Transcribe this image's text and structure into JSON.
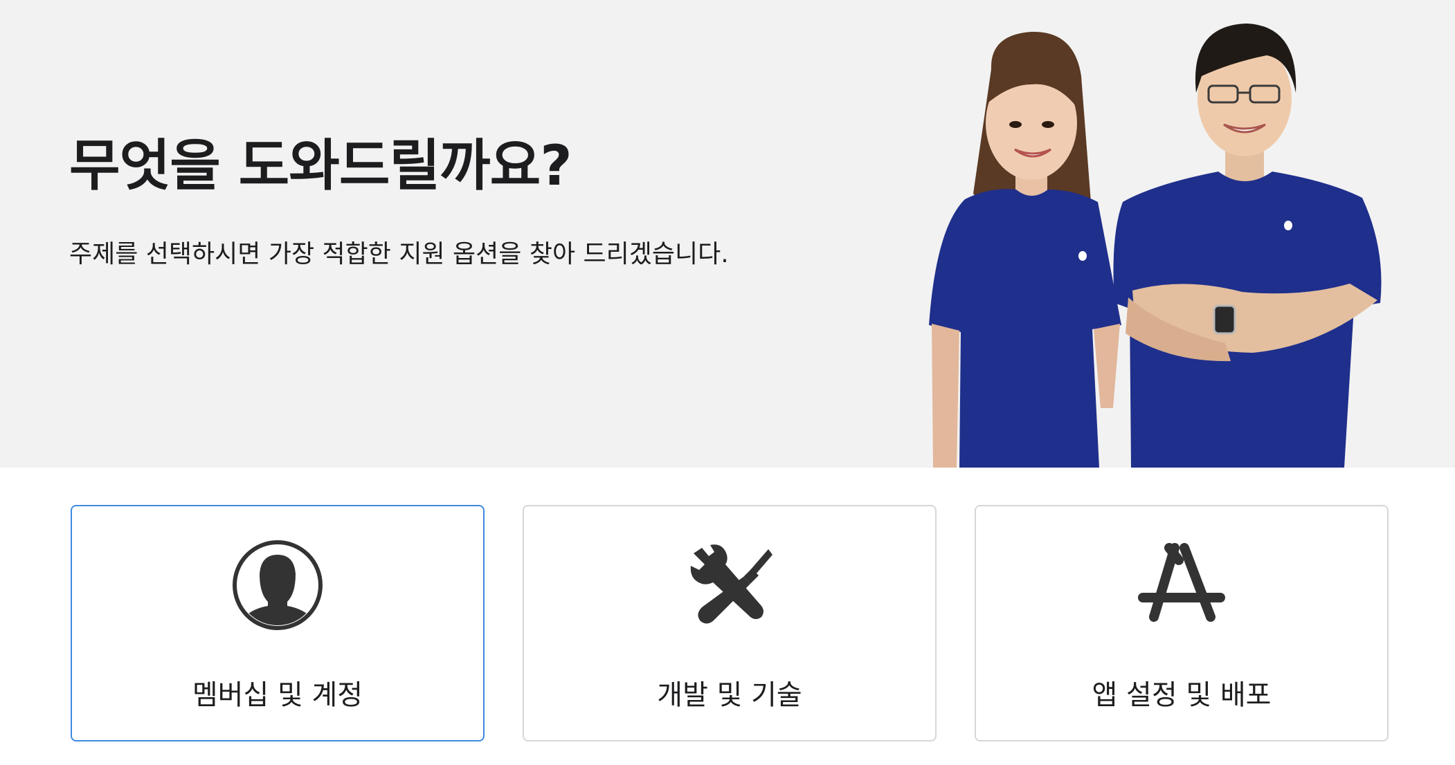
{
  "hero": {
    "title": "무엇을 도와드릴까요?",
    "subtitle": "주제를 선택하시면 가장 적합한 지원 옵션을 찾아 드리겠습니다."
  },
  "cards": [
    {
      "label": "멤버십 및 계정",
      "icon": "person-icon",
      "selected": true
    },
    {
      "label": "개발 및 기술",
      "icon": "tools-icon",
      "selected": false
    },
    {
      "label": "앱 설정 및 배포",
      "icon": "app-store-icon",
      "selected": false
    }
  ],
  "colors": {
    "hero_background": "#f2f2f2",
    "shirt_blue": "#1f2f8c",
    "selected_border": "#3d8ae0",
    "card_border": "#d6d6d6",
    "icon": "#333333"
  }
}
